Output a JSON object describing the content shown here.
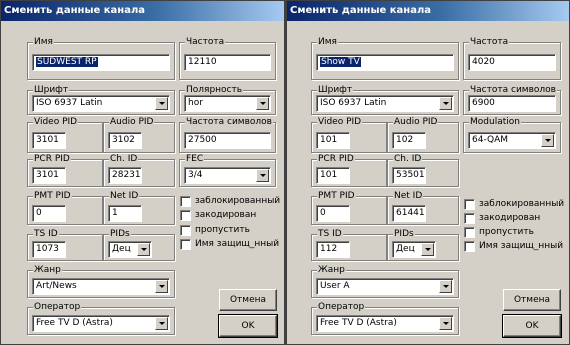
{
  "dialogs": [
    {
      "title": "Сменить данные канала",
      "labels": {
        "name": "Имя",
        "freq": "Частота",
        "font": "Шрифт",
        "third": "Полярность",
        "video_pid": "Video PID",
        "audio_pid": "Audio PID",
        "symrate": "Частота символов",
        "pcr_pid": "PCR PID",
        "ch_id": "Ch. ID",
        "fec": "FEC",
        "pmt_pid": "PMT PID",
        "net_id": "Net ID",
        "ts_id": "TS ID",
        "pids": "PIDs",
        "genre": "Жанр",
        "operator": "Оператор"
      },
      "values": {
        "name": "SUDWEST RP",
        "freq": "12110",
        "font": "ISO 6937 Latin",
        "third": "hor",
        "video_pid": "3101",
        "audio_pid": "3102",
        "symrate": "27500",
        "pcr_pid": "3101",
        "ch_id": "28231",
        "fec": "3/4",
        "pmt_pid": "0",
        "net_id": "1",
        "ts_id": "1073",
        "pids": "Дец",
        "genre": "Art/News",
        "operator": "Free TV D (Astra)"
      },
      "checks": [
        "заблокированный",
        "закодирован",
        "пропустить",
        "Имя защищ_нный"
      ],
      "buttons": {
        "cancel": "Отмена",
        "ok": "OK"
      }
    },
    {
      "title": "Сменить данные канала",
      "labels": {
        "name": "Имя",
        "freq": "Частота",
        "font": "Шрифт",
        "third": "Частота символов",
        "modulation": "Modulation",
        "video_pid": "Video PID",
        "audio_pid": "Audio PID",
        "pcr_pid": "PCR PID",
        "ch_id": "Ch. ID",
        "pmt_pid": "PMT PID",
        "net_id": "Net ID",
        "ts_id": "TS ID",
        "pids": "PIDs",
        "genre": "Жанр",
        "operator": "Оператор"
      },
      "values": {
        "name": "Show TV",
        "freq": "4020",
        "font": "ISO 6937 Latin",
        "third": "6900",
        "modulation": "64-QAM",
        "video_pid": "101",
        "audio_pid": "102",
        "pcr_pid": "101",
        "ch_id": "53501",
        "pmt_pid": "0",
        "net_id": "61441",
        "ts_id": "112",
        "pids": "Дец",
        "genre": "User A",
        "operator": "Free TV D (Astra)"
      },
      "checks": [
        "заблокированный",
        "закодирован",
        "пропустить",
        "Имя защищ_нный"
      ],
      "buttons": {
        "cancel": "Отмена",
        "ok": "OK"
      }
    }
  ]
}
